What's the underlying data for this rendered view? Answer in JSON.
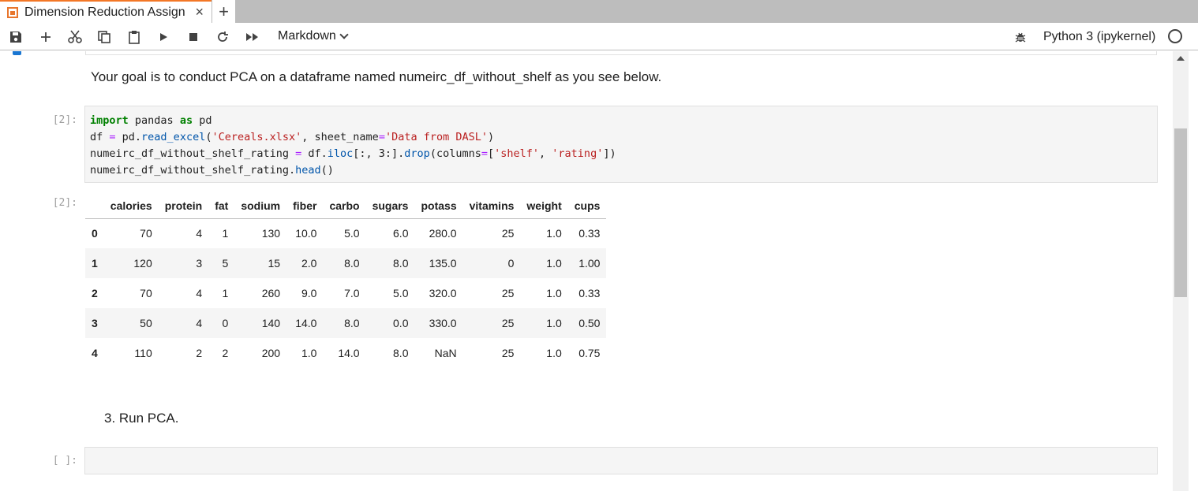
{
  "tab": {
    "title": "Dimension Reduction Assign",
    "close": "×",
    "add": "+"
  },
  "toolbar": {
    "cell_type": "Markdown",
    "kernel_name": "Python 3 (ipykernel)"
  },
  "cells": {
    "intro": "Your goal is to conduct PCA on a dataframe named numeirc_df_without_shelf as you see below.",
    "code_prompt": "[2]:",
    "output_prompt": "[2]:",
    "empty_prompt": "[ ]:",
    "step": "3. Run PCA."
  },
  "code_tokens": {
    "l1_import": "import",
    "l1_a": " pandas ",
    "l1_as": "as",
    "l1_b": " pd",
    "l2_a": "df ",
    "l2_eq": "=",
    "l2_b": " pd.",
    "l2_fn": "read_excel",
    "l2_c": "(",
    "l2_s1": "'Cereals.xlsx'",
    "l2_d": ", sheet_name",
    "l2_eq2": "=",
    "l2_s2": "'Data from DASL'",
    "l2_e": ")",
    "l3_a": "numeirc_df_without_shelf_rating ",
    "l3_eq": "=",
    "l3_b": " df.",
    "l3_fn1": "iloc",
    "l3_c": "[:, 3:].",
    "l3_fn2": "drop",
    "l3_d": "(columns",
    "l3_eq2": "=",
    "l3_e": "[",
    "l3_s1": "'shelf'",
    "l3_f": ", ",
    "l3_s2": "'rating'",
    "l3_g": "])",
    "l4_a": "numeirc_df_without_shelf_rating.",
    "l4_fn": "head",
    "l4_b": "()"
  },
  "table": {
    "columns": [
      "",
      "calories",
      "protein",
      "fat",
      "sodium",
      "fiber",
      "carbo",
      "sugars",
      "potass",
      "vitamins",
      "weight",
      "cups"
    ],
    "rows": [
      [
        "0",
        "70",
        "4",
        "1",
        "130",
        "10.0",
        "5.0",
        "6.0",
        "280.0",
        "25",
        "1.0",
        "0.33"
      ],
      [
        "1",
        "120",
        "3",
        "5",
        "15",
        "2.0",
        "8.0",
        "8.0",
        "135.0",
        "0",
        "1.0",
        "1.00"
      ],
      [
        "2",
        "70",
        "4",
        "1",
        "260",
        "9.0",
        "7.0",
        "5.0",
        "320.0",
        "25",
        "1.0",
        "0.33"
      ],
      [
        "3",
        "50",
        "4",
        "0",
        "140",
        "14.0",
        "8.0",
        "0.0",
        "330.0",
        "25",
        "1.0",
        "0.50"
      ],
      [
        "4",
        "110",
        "2",
        "2",
        "200",
        "1.0",
        "14.0",
        "8.0",
        "NaN",
        "25",
        "1.0",
        "0.75"
      ]
    ]
  },
  "colors": {
    "accent": "#f37726",
    "active": "#1976d2",
    "keyword": "#008000",
    "string": "#ba2121"
  }
}
